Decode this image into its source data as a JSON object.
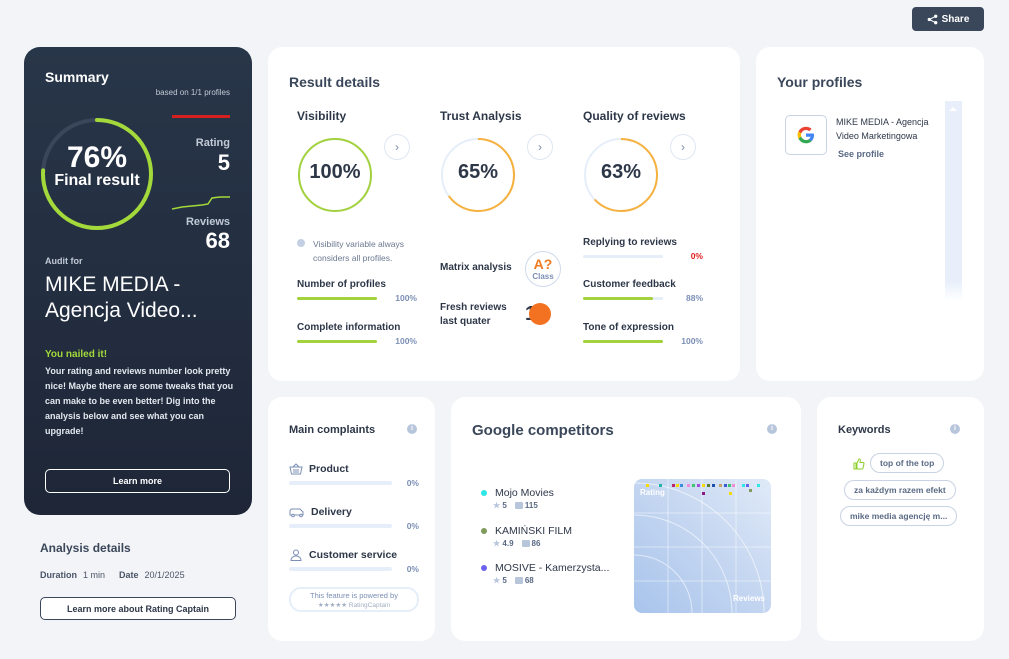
{
  "header": {
    "share_label": "Share"
  },
  "summary": {
    "title": "Summary",
    "based_on": "based on 1/1 profiles",
    "final_pct": "76%",
    "final_value": 0.76,
    "final_label": "Final result",
    "rating_label": "Rating",
    "rating_value": "5",
    "reviews_label": "Reviews",
    "reviews_value": "68",
    "audit_for": "Audit for",
    "business_name": "MIKE MEDIA - Agencja Video...",
    "status_title": "You nailed it!",
    "status_text": "Your rating and reviews number look pretty nice! Maybe there are some tweaks that you can make to be even better! Dig into the analysis below and see what you can upgrade!",
    "learn_more": "Learn more",
    "colors": {
      "accent": "#a3d93a",
      "danger": "#d61f1f"
    }
  },
  "analysis": {
    "title": "Analysis details",
    "duration_label": "Duration",
    "duration_value": "1 min",
    "date_label": "Date",
    "date_value": "20/1/2025",
    "about_button": "Learn more about Rating Captain"
  },
  "results": {
    "title": "Result details",
    "columns": [
      {
        "title": "Visibility",
        "pct": "100%",
        "value": 1.0,
        "color": "#a3d23e"
      },
      {
        "title": "Trust Analysis",
        "pct": "65%",
        "value": 0.65,
        "color": "#f6b13e"
      },
      {
        "title": "Quality of reviews",
        "pct": "63%",
        "value": 0.63,
        "color": "#f6b13e"
      }
    ],
    "visibility_note": "Visibility variable always considers all profiles.",
    "visibility_metrics": [
      {
        "name": "Number of profiles",
        "pct": "100%",
        "value": 1.0
      },
      {
        "name": "Complete information",
        "pct": "100%",
        "value": 1.0
      }
    ],
    "trust": {
      "matrix_label": "Matrix analysis",
      "matrix_grade": "A?",
      "matrix_class": "Class",
      "fresh_label": "Fresh reviews last quater",
      "fresh_value": "1"
    },
    "quality_metrics": [
      {
        "name": "Replying to reviews",
        "pct": "0%",
        "value": 0.0
      },
      {
        "name": "Customer feedback",
        "pct": "88%",
        "value": 0.88
      },
      {
        "name": "Tone of expression",
        "pct": "100%",
        "value": 1.0
      }
    ]
  },
  "profiles": {
    "title": "Your profiles",
    "items": [
      {
        "name": "MIKE MEDIA - Agencja Video Marketingowa",
        "link": "See profile",
        "icon": "google-icon"
      }
    ]
  },
  "complaints": {
    "title": "Main complaints",
    "items": [
      {
        "name": "Product",
        "pct": "0%",
        "icon": "basket-icon"
      },
      {
        "name": "Delivery",
        "pct": "0%",
        "icon": "truck-icon"
      },
      {
        "name": "Customer service",
        "pct": "0%",
        "icon": "person-icon"
      }
    ],
    "powered_by": "This feature is powered by",
    "powered_brand": "★★★★★ RatingCaptain"
  },
  "competitors": {
    "title": "Google competitors",
    "items": [
      {
        "name": "Mojo Movies",
        "rating": "5",
        "reviews": "115",
        "color": "#2ee6e6"
      },
      {
        "name": "KAMIŃSKI FILM",
        "rating": "4.9",
        "reviews": "86",
        "color": "#7f9a5a"
      },
      {
        "name": "MOSIVE - Kamerzysta...",
        "rating": "5",
        "reviews": "68",
        "color": "#6b63f0"
      }
    ],
    "chart_y_label": "Rating",
    "chart_x_label": "Reviews"
  },
  "keywords": {
    "title": "Keywords",
    "items": [
      "top of the top",
      "za każdym razem efekt",
      "mike media agencję m..."
    ]
  }
}
